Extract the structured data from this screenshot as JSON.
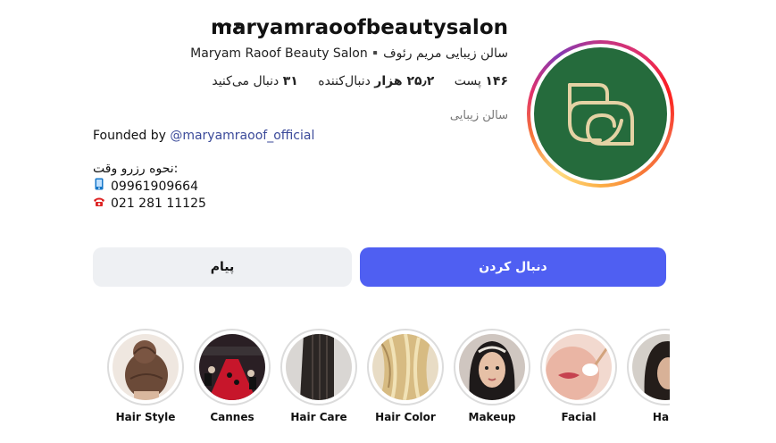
{
  "profile": {
    "username": "maryamraoofbeautysalon",
    "more_icon": "•••",
    "full_name": "سالن زیبایی مریم رئوف▪️Maryam Raoof Beauty Salon",
    "stats": {
      "posts_count": "۱۴۶",
      "posts_label": "پست",
      "followers_count": "۲۵٫۲ هزار",
      "followers_label": "دنبال‌کننده",
      "following_count": "۳۱",
      "following_label": "دنبال می‌کنید"
    },
    "category": "سالن زیبایی",
    "bio": {
      "founded_prefix": "Founded by ",
      "founded_mention": "@maryamraoof_official",
      "booking_title": "نحوه رزرو وقت:",
      "phone_icon": "mobile-phone-icon",
      "phone": "09961909664",
      "tel_icon": "telephone-icon",
      "tel": "021 281 11125"
    },
    "avatar_icon": "salon-logo",
    "colors": {
      "avatar_bg": "#256b3c",
      "logo": "#e4d2a4",
      "follow_button": "#4f5ff2",
      "message_button": "#eef0f3"
    }
  },
  "actions": {
    "follow_label": "دنبال کردن",
    "message_label": "پیام"
  },
  "highlights": [
    {
      "label": "Hair Style",
      "icon": "hair-bun-photo"
    },
    {
      "label": "Cannes",
      "icon": "red-carpet-photo"
    },
    {
      "label": "Hair Care",
      "icon": "dark-hair-photo"
    },
    {
      "label": "Hair Color",
      "icon": "blonde-hair-photo"
    },
    {
      "label": "Makeup",
      "icon": "makeup-model-photo"
    },
    {
      "label": "Facial",
      "icon": "facial-treatment-photo"
    },
    {
      "label": "Hair",
      "icon": "hair-photo"
    }
  ]
}
